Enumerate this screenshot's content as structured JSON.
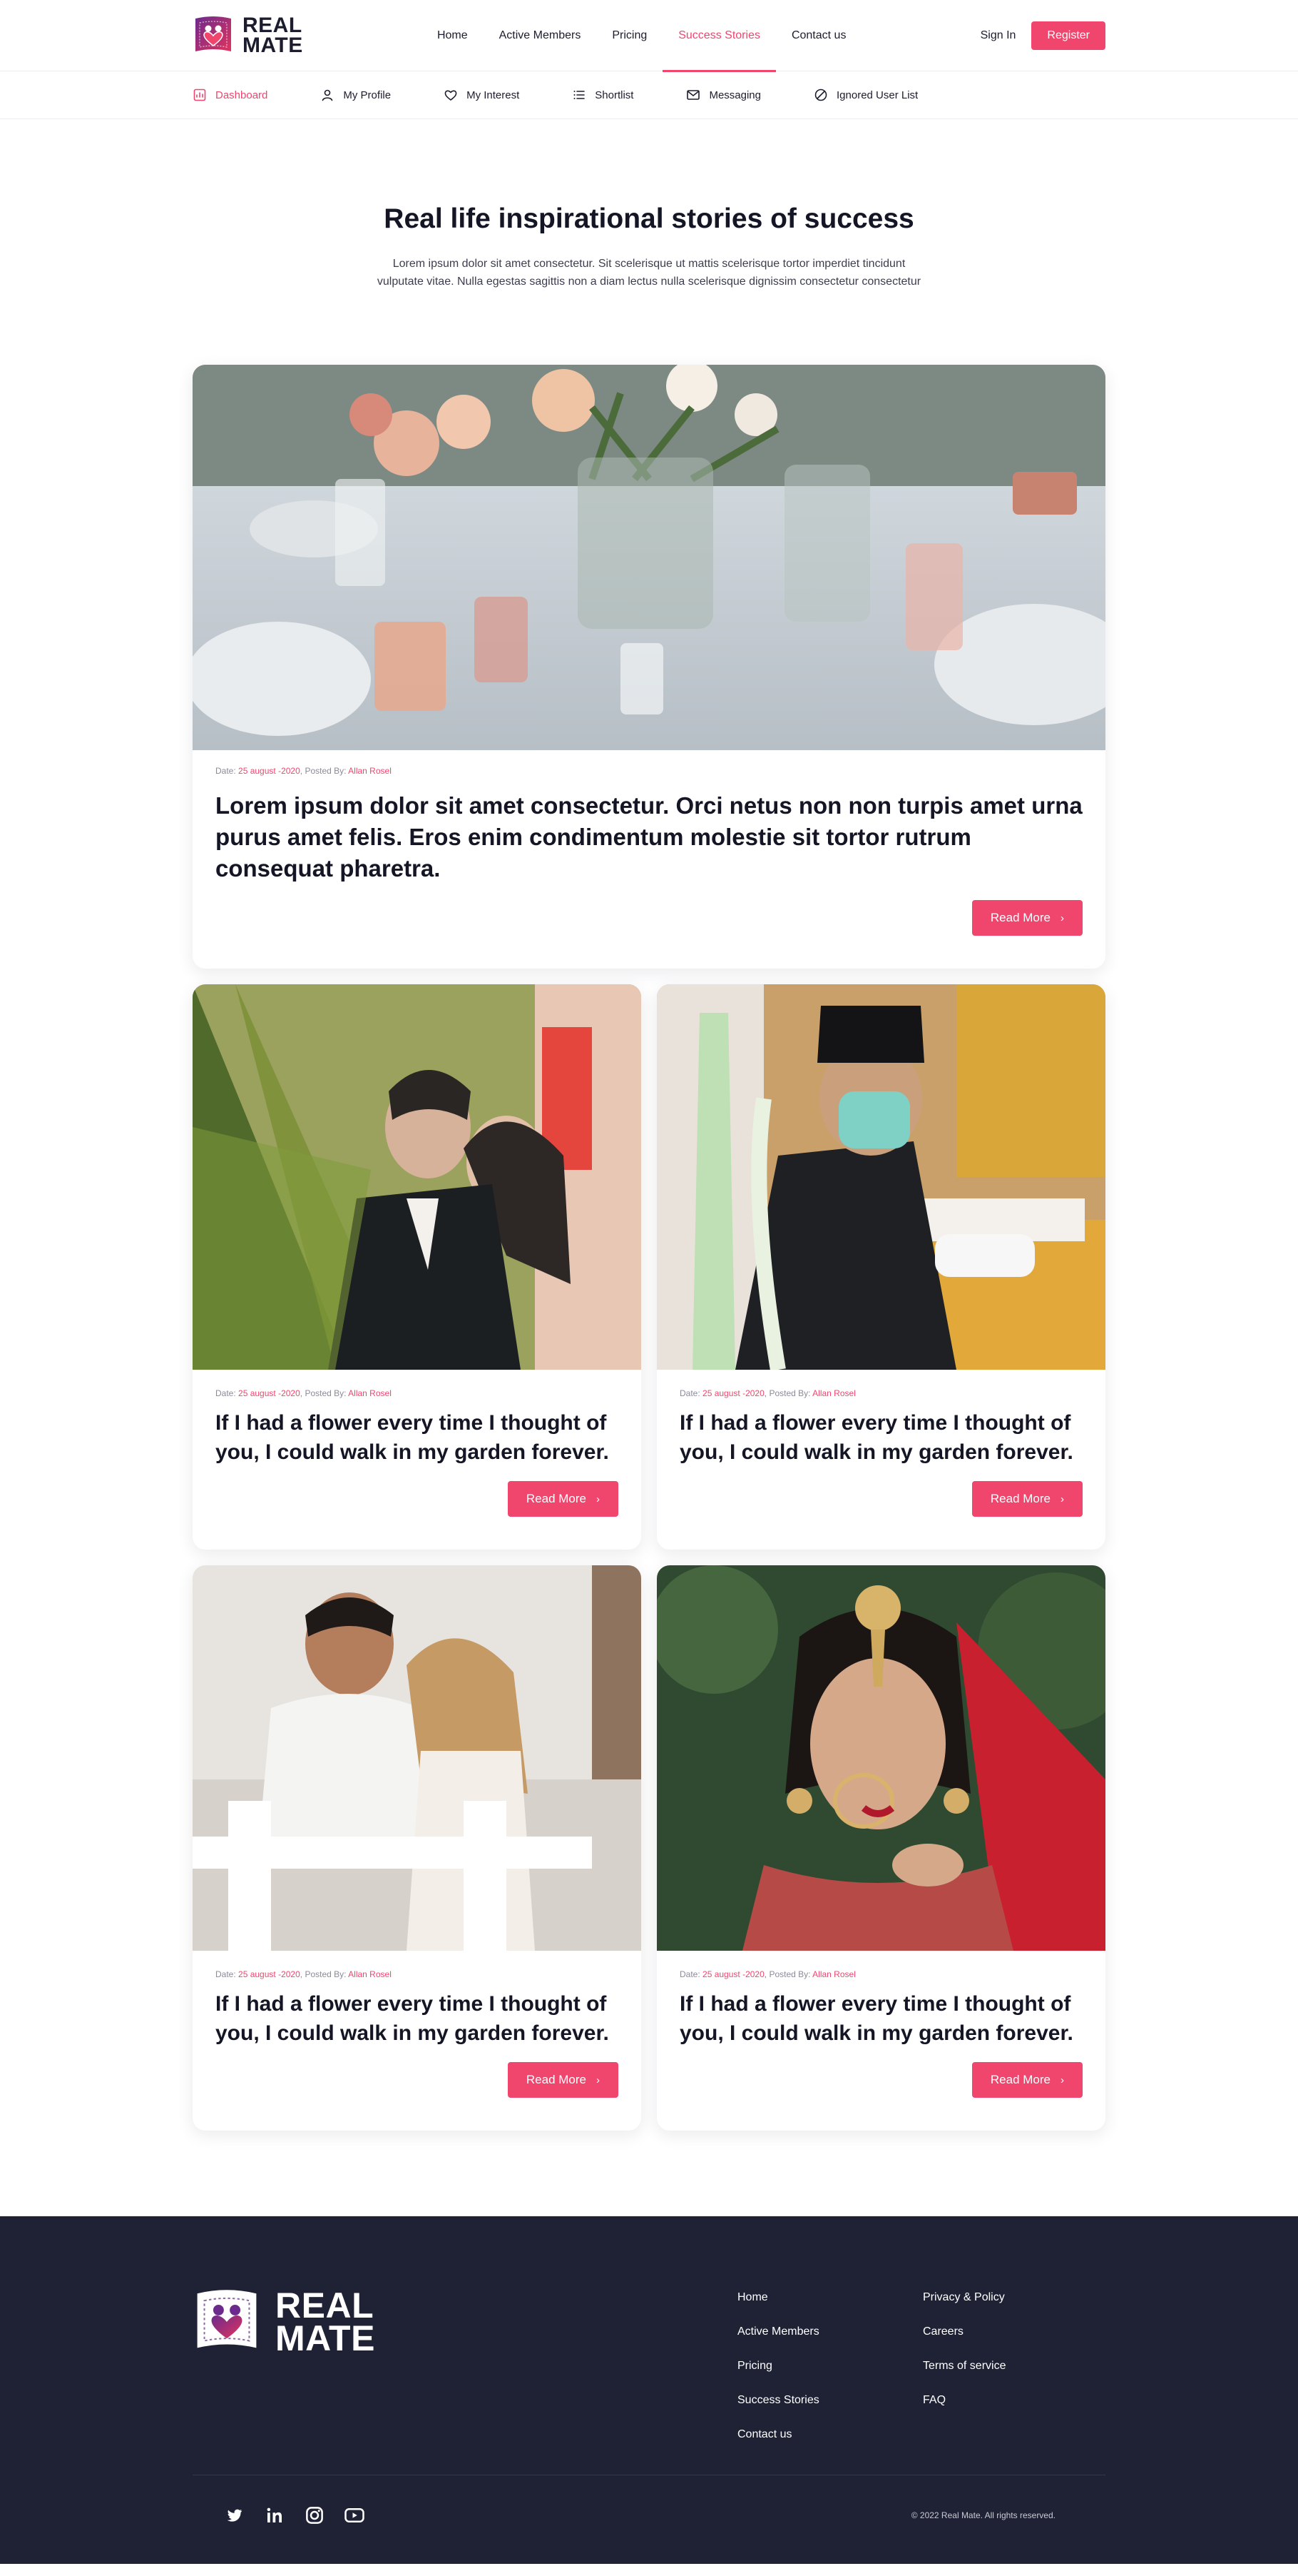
{
  "brand": {
    "line1": "REAL",
    "line2": "MATE"
  },
  "nav": {
    "items": [
      {
        "label": "Home"
      },
      {
        "label": "Active Members"
      },
      {
        "label": "Pricing"
      },
      {
        "label": "Success Stories",
        "active": true
      },
      {
        "label": "Contact us"
      }
    ],
    "signin": "Sign In",
    "register": "Register"
  },
  "subnav": {
    "items": [
      {
        "label": "Dashboard",
        "icon": "dashboard-icon",
        "active": true
      },
      {
        "label": "My Profile",
        "icon": "user-icon"
      },
      {
        "label": "My Interest",
        "icon": "heart-icon"
      },
      {
        "label": "Shortlist",
        "icon": "list-icon"
      },
      {
        "label": "Messaging",
        "icon": "mail-icon"
      },
      {
        "label": "Ignored User List",
        "icon": "ban-icon"
      }
    ]
  },
  "hero": {
    "title": "Real life inspirational stories of success",
    "text": "Lorem ipsum dolor sit amet consectetur. Sit scelerisque ut mattis scelerisque tortor imperdiet tincidunt vulputate vitae. Nulla egestas sagittis non a diam lectus nulla scelerisque dignissim consectetur consectetur"
  },
  "featured": {
    "date_label": "Date:",
    "date": "25 august -2020",
    "posted_label": ", Posted By:",
    "author": "Allan Rosel",
    "title": "Lorem ipsum dolor sit amet consectetur. Orci netus non non turpis amet urna purus amet felis. Eros enim condimentum molestie sit tortor rutrum consequat pharetra.",
    "button": "Read More"
  },
  "stories": [
    {
      "date_label": "Date:",
      "date": "25 august -2020",
      "posted_label": ", Posted By:",
      "author": "Allan Rosel",
      "title": "If I had a flower every time I thought of you, I could walk in my garden forever.",
      "button": "Read More"
    },
    {
      "date_label": "Date:",
      "date": "25 august -2020",
      "posted_label": ", Posted By:",
      "author": "Allan Rosel",
      "title": "If I had a flower every time I thought of you, I could walk in my garden forever.",
      "button": "Read More"
    },
    {
      "date_label": "Date:",
      "date": "25 august -2020",
      "posted_label": ", Posted By:",
      "author": "Allan Rosel",
      "title": "If I had a flower every time I thought of you, I could walk in my garden forever.",
      "button": "Read More"
    },
    {
      "date_label": "Date:",
      "date": "25 august -2020",
      "posted_label": ", Posted By:",
      "author": "Allan Rosel",
      "title": "If I had a flower every time I thought of you, I could walk in my garden forever.",
      "button": "Read More"
    }
  ],
  "footer": {
    "col1": [
      "Home",
      "Active Members",
      "Pricing",
      "Success Stories",
      "Contact us"
    ],
    "col2": [
      "Privacy & Policy",
      "Careers",
      "Terms of service",
      "FAQ"
    ],
    "socials": [
      "twitter-icon",
      "linkedin-icon",
      "instagram-icon",
      "youtube-icon"
    ],
    "copyright": "© 2022 Real Mate. All rights reserved."
  },
  "colors": {
    "accent": "#f0466e",
    "dark": "#1f2235",
    "brand_purple": "#6b2a8c"
  }
}
